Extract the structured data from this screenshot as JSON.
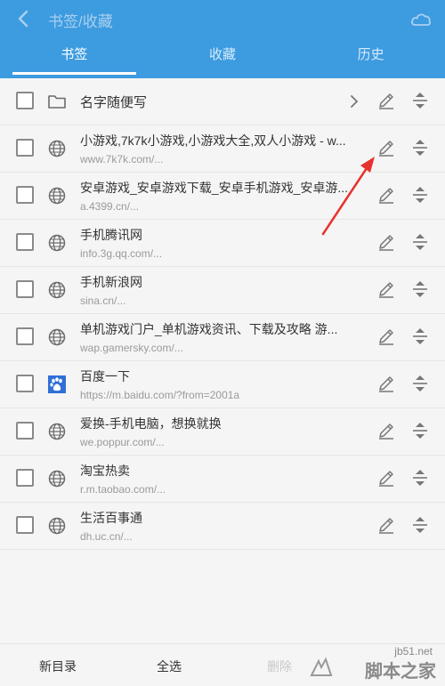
{
  "header": {
    "title": "书签/收藏",
    "tabs": [
      {
        "label": "书签",
        "active": true
      },
      {
        "label": "收藏",
        "active": false
      },
      {
        "label": "历史",
        "active": false
      }
    ]
  },
  "folder": {
    "name": "名字随便写",
    "icon": "folder-icon"
  },
  "bookmarks": [
    {
      "title": "小游戏,7k7k小游戏,小游戏大全,双人小游戏 - w...",
      "url": "www.7k7k.com/...",
      "icon": "globe-icon"
    },
    {
      "title": "安卓游戏_安卓游戏下载_安卓手机游戏_安卓游...",
      "url": "a.4399.cn/...",
      "icon": "globe-icon"
    },
    {
      "title": "手机腾讯网",
      "url": "info.3g.qq.com/...",
      "icon": "globe-icon"
    },
    {
      "title": "手机新浪网",
      "url": "sina.cn/...",
      "icon": "globe-icon"
    },
    {
      "title": "单机游戏门户_单机游戏资讯、下载及攻略 游...",
      "url": "wap.gamersky.com/...",
      "icon": "globe-icon"
    },
    {
      "title": "百度一下",
      "url": "https://m.baidu.com/?from=2001a",
      "icon": "baidu-paw-icon"
    },
    {
      "title": "爱换-手机电脑，想换就换",
      "url": "we.poppur.com/...",
      "icon": "globe-icon"
    },
    {
      "title": "淘宝热卖",
      "url": "r.m.taobao.com/...",
      "icon": "globe-icon"
    },
    {
      "title": "生活百事通",
      "url": "dh.uc.cn/...",
      "icon": "globe-icon"
    }
  ],
  "bottom_bar": {
    "new_folder": "新目录",
    "select_all": "全选",
    "delete": "删除"
  },
  "watermark": {
    "site": "jb51.net",
    "brand": "脚本之家"
  },
  "colors": {
    "header": "#3d9be0",
    "annotation_arrow": "#e8322d"
  }
}
